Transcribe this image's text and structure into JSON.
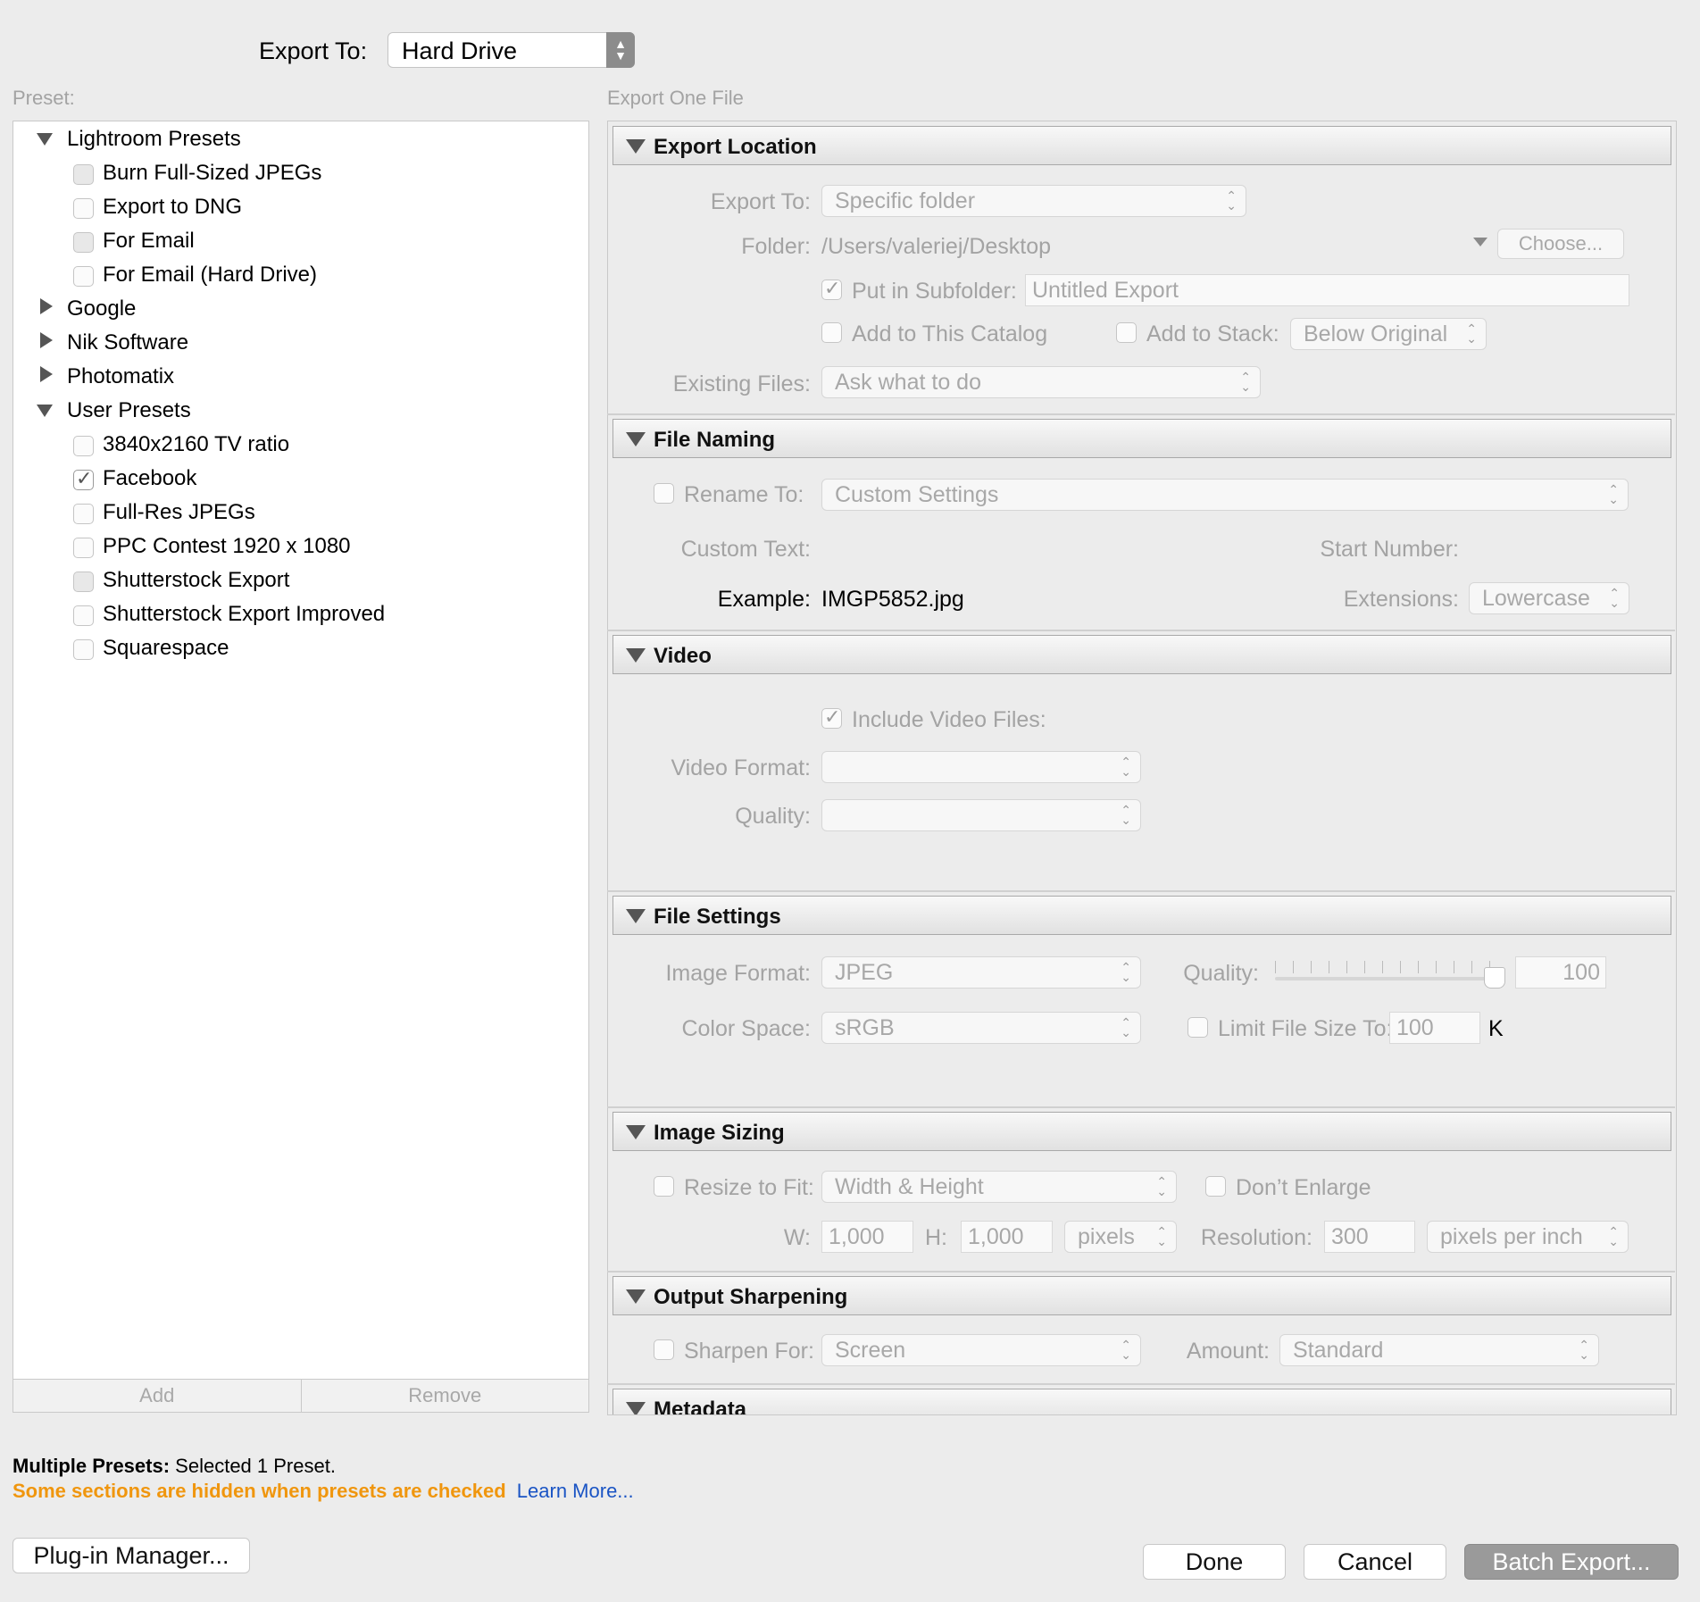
{
  "header": {
    "export_to_label": "Export To:",
    "export_to_value": "Hard Drive"
  },
  "preset_panel": {
    "title": "Preset:",
    "groups": [
      {
        "name": "Lightroom Presets",
        "expanded": true,
        "items": [
          "Burn Full-Sized JPEGs",
          "Export to DNG",
          "For Email",
          "For Email (Hard Drive)"
        ]
      },
      {
        "name": "Google",
        "expanded": false
      },
      {
        "name": "Nik Software",
        "expanded": false
      },
      {
        "name": "Photomatix",
        "expanded": false
      },
      {
        "name": "User Presets",
        "expanded": true,
        "items": [
          "3840x2160 TV ratio",
          "Facebook",
          "Full-Res JPEGs",
          "PPC Contest 1920 x 1080",
          "Shutterstock Export",
          "Shutterstock Export Improved",
          "Squarespace"
        ],
        "checked_item": "Facebook"
      }
    ],
    "add_label": "Add",
    "remove_label": "Remove"
  },
  "right_title": "Export One File",
  "sections": {
    "export_location": {
      "title": "Export Location",
      "export_to_label": "Export To:",
      "export_to_value": "Specific folder",
      "folder_label": "Folder:",
      "folder_value": "/Users/valeriej/Desktop",
      "choose_label": "Choose...",
      "subfolder_label": "Put in Subfolder:",
      "subfolder_value": "Untitled Export",
      "add_catalog_label": "Add to This Catalog",
      "add_stack_label": "Add to Stack:",
      "stack_value": "Below Original",
      "existing_label": "Existing Files:",
      "existing_value": "Ask what to do"
    },
    "file_naming": {
      "title": "File Naming",
      "rename_label": "Rename To:",
      "rename_value": "Custom Settings",
      "custom_text_label": "Custom Text:",
      "start_number_label": "Start Number:",
      "example_label": "Example:",
      "example_value": "IMGP5852.jpg",
      "extensions_label": "Extensions:",
      "extensions_value": "Lowercase"
    },
    "video": {
      "title": "Video",
      "include_label": "Include Video Files:",
      "format_label": "Video Format:",
      "quality_label": "Quality:"
    },
    "file_settings": {
      "title": "File Settings",
      "format_label": "Image Format:",
      "format_value": "JPEG",
      "quality_label": "Quality:",
      "quality_value": "100",
      "colorspace_label": "Color Space:",
      "colorspace_value": "sRGB",
      "limit_label": "Limit File Size To:",
      "limit_value": "100",
      "limit_unit": "K"
    },
    "image_sizing": {
      "title": "Image Sizing",
      "resize_label": "Resize to Fit:",
      "resize_value": "Width & Height",
      "dont_enlarge_label": "Don’t Enlarge",
      "w_label": "W:",
      "w_value": "1,000",
      "h_label": "H:",
      "h_value": "1,000",
      "unit_value": "pixels",
      "resolution_label": "Resolution:",
      "resolution_value": "300",
      "resolution_unit": "pixels per inch"
    },
    "output_sharpening": {
      "title": "Output Sharpening",
      "sharpen_label": "Sharpen For:",
      "sharpen_value": "Screen",
      "amount_label": "Amount:",
      "amount_value": "Standard"
    },
    "metadata": {
      "title": "Metadata"
    }
  },
  "footer": {
    "multiple_label": "Multiple Presets:",
    "multiple_value": "Selected 1 Preset.",
    "warning": "Some sections are hidden when presets are checked",
    "learn_more": "Learn More...",
    "plugin_manager": "Plug-in Manager...",
    "done": "Done",
    "cancel": "Cancel",
    "batch_export": "Batch Export..."
  },
  "colors": {
    "warning": "#f0960e",
    "link": "#1a54c4",
    "primary_button": "#9a9a9a"
  }
}
